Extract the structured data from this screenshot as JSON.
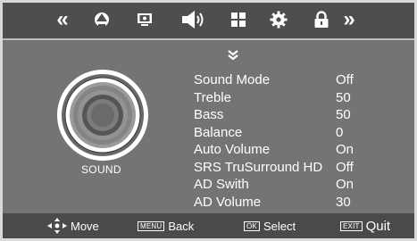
{
  "top_nav": {
    "items": [
      {
        "icon": "chevrons-left-icon",
        "glyph": "«"
      },
      {
        "icon": "picture-icon"
      },
      {
        "icon": "screen-icon"
      },
      {
        "icon": "speaker-icon"
      },
      {
        "icon": "grid-icon"
      },
      {
        "icon": "gear-icon"
      },
      {
        "icon": "lock-icon"
      },
      {
        "icon": "chevrons-right-icon",
        "glyph": "»"
      }
    ],
    "active": "speaker-icon"
  },
  "sound_panel": {
    "label": "SOUND",
    "menu": [
      {
        "label": "Sound Mode",
        "value": "Off"
      },
      {
        "label": "Treble",
        "value": "50"
      },
      {
        "label": "Bass",
        "value": "50"
      },
      {
        "label": "Balance",
        "value": "0"
      },
      {
        "label": "Auto Volume",
        "value": "On"
      },
      {
        "label": "SRS TruSurround HD",
        "value": "Off"
      },
      {
        "label": "AD Swith",
        "value": "On"
      },
      {
        "label": "AD Volume",
        "value": "30"
      }
    ]
  },
  "bottom_bar": {
    "move": "Move",
    "menu_key": "MENU",
    "back": "Back",
    "ok_key": "OK",
    "select": "Select",
    "exit_key": "EXIT",
    "quit": "Quit"
  },
  "colors": {
    "top_bar": "#4e4e4e",
    "content": "#747474",
    "bottom_bar": "#4a4a4a",
    "text": "#ffffff"
  }
}
